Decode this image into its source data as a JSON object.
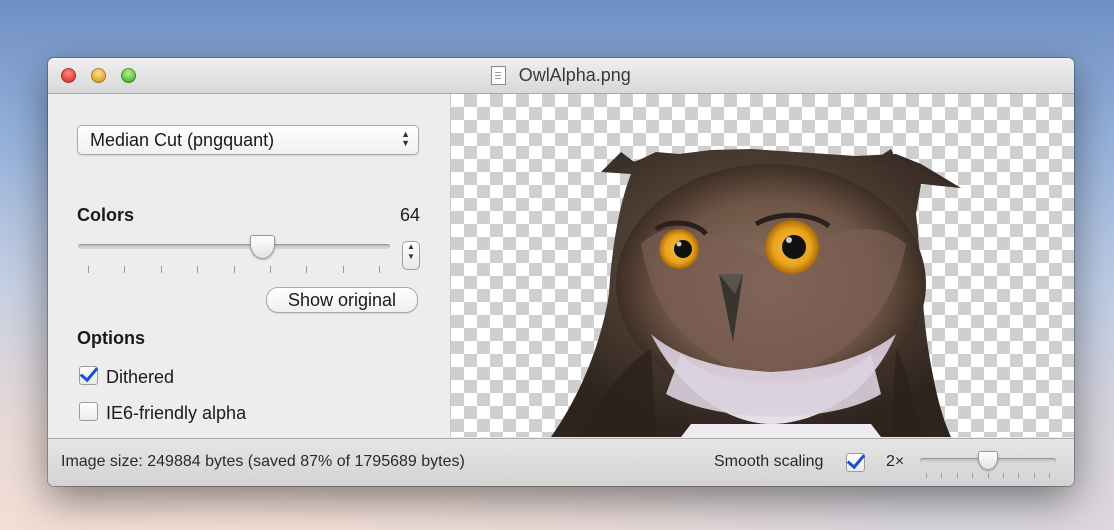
{
  "window": {
    "title": "OwlAlpha.png",
    "title_icon": "png-file-icon"
  },
  "sidebar": {
    "algorithm": {
      "selected": "Median Cut (pngquant)",
      "icon": "up-down-chevron-icon"
    },
    "colors": {
      "label": "Colors",
      "value": "64",
      "slider_fraction": 0.6,
      "tick_count": 9
    },
    "show_original_label": "Show original",
    "options": {
      "label": "Options",
      "dithered": {
        "label": "Dithered",
        "checked": true
      },
      "ie6_alpha": {
        "label": "IE6-friendly alpha",
        "checked": false
      }
    }
  },
  "status": {
    "image_size_text": "Image size: 249884 bytes (saved 87% of 1795689 bytes)",
    "smooth_scaling_label": "Smooth scaling",
    "smooth_scaling_checked": true,
    "zoom_label": "2×",
    "zoom_fraction": 0.5,
    "zoom_tick_count": 9
  },
  "colors": {
    "accent_check": "#1b4fd8",
    "close": "#e0443e",
    "minimize": "#e2a92e",
    "maximize": "#5fbf3d",
    "owl_eye": "#e9a21a"
  }
}
